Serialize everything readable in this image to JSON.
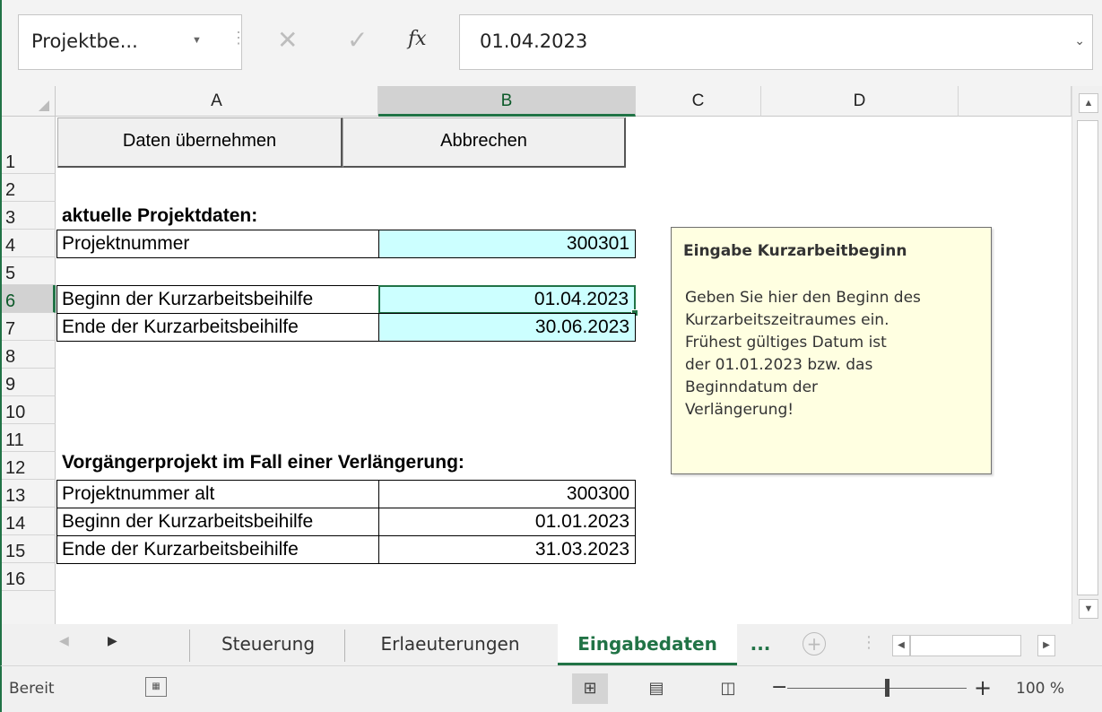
{
  "formula_bar": {
    "name_box": "Projektbe...",
    "fx_label": "fx",
    "content": "01.04.2023"
  },
  "columns": [
    "A",
    "B",
    "C",
    "D"
  ],
  "rows": [
    "1",
    "2",
    "3",
    "4",
    "5",
    "6",
    "7",
    "8",
    "9",
    "10",
    "11",
    "12",
    "13",
    "14",
    "15",
    "16"
  ],
  "buttons": {
    "apply": "Daten übernehmen",
    "cancel": "Abbrechen"
  },
  "current": {
    "heading": "aktuelle Projektdaten:",
    "project_number_label": "Projektnummer",
    "project_number": "300301",
    "begin_label": "Beginn der Kurzarbeitsbeihilfe",
    "begin": "01.04.2023",
    "end_label": "Ende der Kurzarbeitsbeihilfe",
    "end": "30.06.2023"
  },
  "previous": {
    "heading": "Vorgängerprojekt im Fall einer Verlängerung:",
    "project_number_label": "Projektnummer alt",
    "project_number": "300300",
    "begin_label": "Beginn der Kurzarbeitsbeihilfe",
    "begin": "01.01.2023",
    "end_label": "Ende der Kurzarbeitsbeihilfe",
    "end": "31.03.2023"
  },
  "note": {
    "title": "Eingabe Kurzarbeitbeginn",
    "line1": "Geben Sie hier den Beginn des",
    "line2": "Kurzarbeitszeitraumes ein.",
    "line3": "Frühest gültiges Datum ist",
    "line4": "der 01.01.2023 bzw. das",
    "line5": "Beginndatum der",
    "line6": "Verlängerung!"
  },
  "sheet_tabs": [
    "Steuerung",
    "Erlaeuterungen",
    "Eingabedaten"
  ],
  "tabs_more": "...",
  "status": {
    "ready": "Bereit",
    "zoom": "100 %"
  },
  "colors": {
    "accent": "#217346",
    "input_fill": "#ccffff",
    "note_fill": "#ffffe1"
  }
}
